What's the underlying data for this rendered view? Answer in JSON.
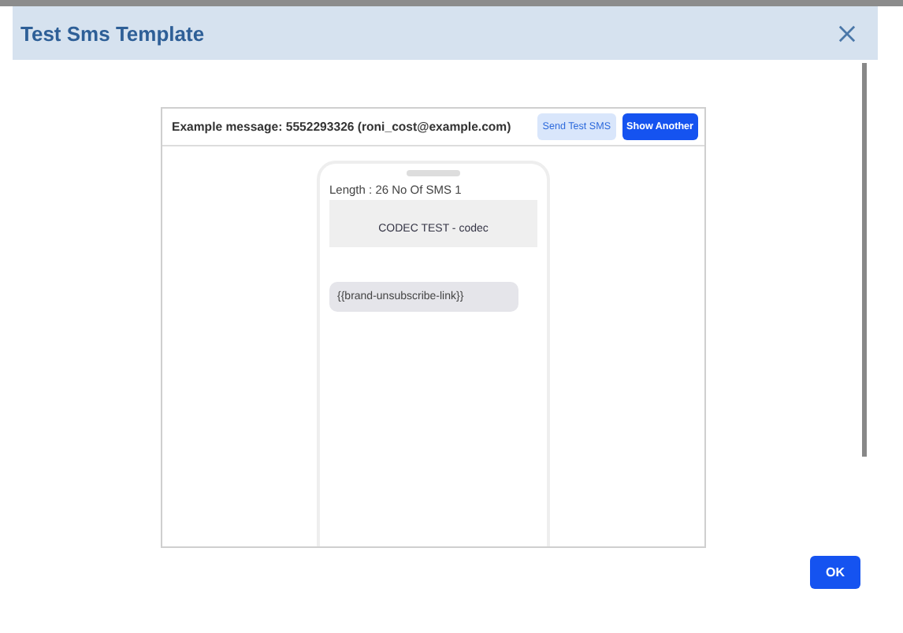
{
  "dialog": {
    "title": "Test Sms Template"
  },
  "preview": {
    "example_message": "Example message: 5552293326 (roni_cost@example.com)",
    "buttons": [
      {
        "label": "Send Test SMS",
        "kind": "secondary"
      },
      {
        "label": "Show Another",
        "kind": "primary"
      }
    ],
    "phone": {
      "length_info": "Length : 26 No Of SMS 1",
      "sender": "CODEC TEST - codec",
      "messages": [
        "{{brand-unsubscribe-link}}"
      ]
    }
  },
  "footer": {
    "buttons": [
      {
        "label": "OK",
        "kind": "primary"
      }
    ]
  }
}
